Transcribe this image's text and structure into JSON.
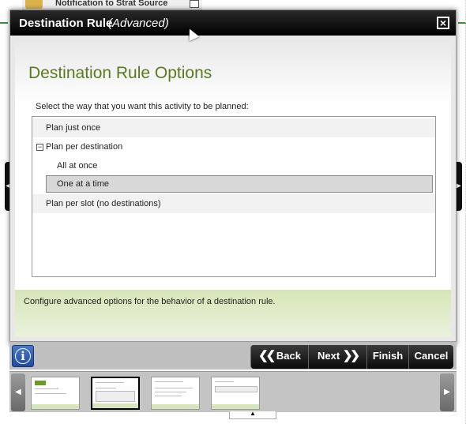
{
  "background": {
    "tab_label": "Notification to Strat Source"
  },
  "dialog": {
    "title": "Destination Rule",
    "subtitle": "(Advanced)",
    "close_glyph": "☒"
  },
  "page": {
    "heading": "Destination Rule Options",
    "instruction": "Select the way that you want this activity to be planned:"
  },
  "options": [
    {
      "label": "Plan just once",
      "selected": false
    },
    {
      "label": "Plan per destination",
      "expanded": true,
      "toggle": "−"
    },
    {
      "label": "All at once",
      "selected": false
    },
    {
      "label": "One at a time",
      "selected": true
    },
    {
      "label": "Plan per slot (no destinations)",
      "selected": false
    }
  ],
  "help": {
    "text": "Configure advanced options for the behavior of a destination rule."
  },
  "toolbar": {
    "info_glyph": "i",
    "back_label": "Back",
    "back_chev": "❮❮",
    "next_label": "Next",
    "next_chev": "❯❯",
    "finish_label": "Finish",
    "cancel_label": "Cancel"
  },
  "icons": {
    "side_left": "◀",
    "side_right": "▶",
    "strip_left": "◀",
    "strip_right": "▶",
    "tab_up": "▲"
  },
  "thumbnails": {
    "active_index": 2,
    "count": 4
  },
  "colors": {
    "title_green": "#5a7a1e",
    "help_bg": "#d6e6b8",
    "selected_bg": "#d8d8d8"
  }
}
